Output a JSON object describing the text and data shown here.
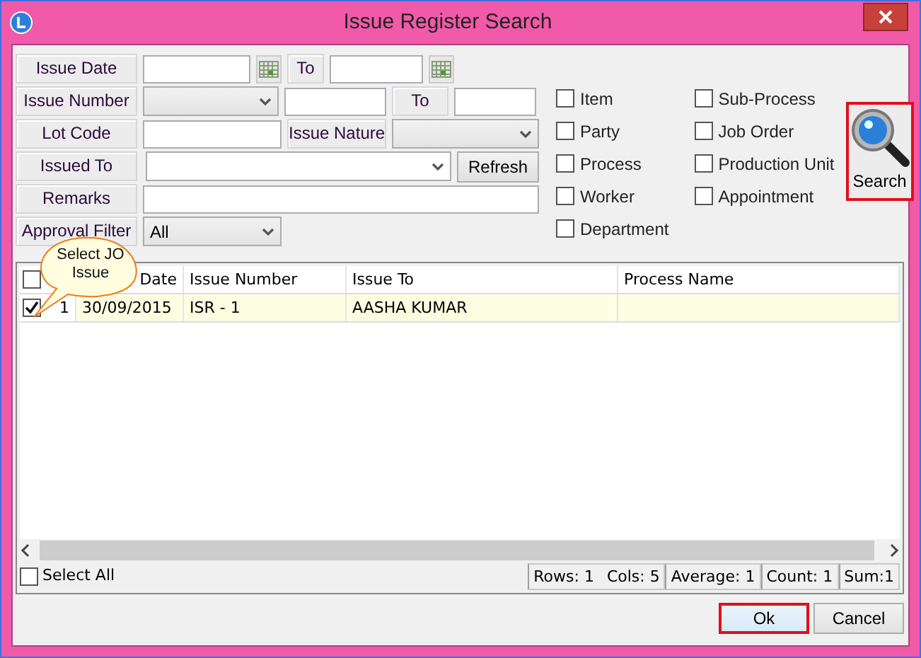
{
  "window": {
    "title": "Issue Register Search"
  },
  "filter_rows": [
    [
      {
        "kind": "label",
        "text": "Issue Date"
      },
      {
        "kind": "date"
      },
      {
        "kind": "label",
        "text": "To"
      },
      {
        "kind": "date"
      }
    ],
    [
      {
        "kind": "label",
        "text": "Issue Number"
      },
      {
        "kind": "select"
      },
      {
        "kind": "input"
      },
      {
        "kind": "label",
        "text": "To"
      },
      {
        "kind": "input"
      }
    ],
    [
      {
        "kind": "label",
        "text": "Lot Code"
      },
      {
        "kind": "input"
      },
      {
        "kind": "label",
        "text": "Issue Nature"
      },
      {
        "kind": "select"
      }
    ],
    [
      {
        "kind": "label",
        "text": "Issued To"
      },
      {
        "kind": "select"
      },
      {
        "kind": "button",
        "text": "Refresh"
      }
    ],
    [
      {
        "kind": "label",
        "text": "Remarks"
      },
      {
        "kind": "input"
      }
    ],
    [
      {
        "kind": "label",
        "text": "Approval Filter"
      },
      {
        "kind": "select",
        "value": "All"
      }
    ]
  ],
  "option_columns": [
    [
      {
        "label": "Item",
        "checked": false
      },
      {
        "label": "Party",
        "checked": false
      },
      {
        "label": "Process",
        "checked": false
      },
      {
        "label": "Worker",
        "checked": false
      },
      {
        "label": "Department",
        "checked": false
      }
    ],
    [
      {
        "label": "Sub-Process",
        "checked": false
      },
      {
        "label": "Job Order",
        "checked": false
      },
      {
        "label": "Production Unit",
        "checked": false
      },
      {
        "label": "Appointment",
        "checked": false
      }
    ]
  ],
  "search_button": {
    "label": "Search",
    "highlighted": true
  },
  "callout": {
    "text": "Select JO Issue"
  },
  "grid": {
    "header_checked": false,
    "columns": [
      "Date",
      "Issue Number",
      "Issue To",
      "Process Name"
    ],
    "rows": [
      {
        "checked": true,
        "row_number": "1",
        "cells": [
          "30/09/2015",
          "ISR - 1",
          "AASHA KUMAR"
        ]
      }
    ]
  },
  "select_all": {
    "label": "Select All",
    "checked": false
  },
  "status_segments": [
    [
      "Rows: 1",
      "Cols: 5"
    ],
    [
      "Average: 1"
    ],
    [
      "Count: 1"
    ],
    [
      "Sum:1"
    ]
  ],
  "buttons": [
    {
      "label": "Ok",
      "highlighted": true
    },
    {
      "label": "Cancel",
      "highlighted": false
    }
  ]
}
